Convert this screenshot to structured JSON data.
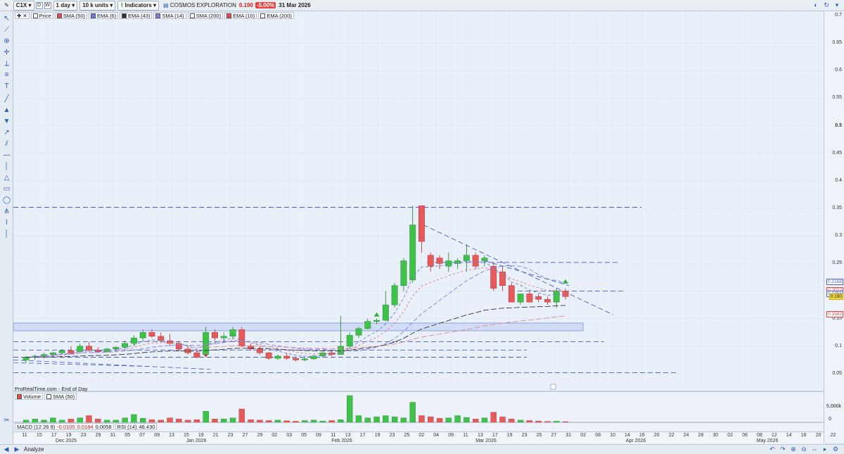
{
  "toolbar": {
    "symbol": "C1X",
    "period": "1 day",
    "units": "10 k units",
    "indicators_label": "Indicators",
    "instrument_name": "COSMOS EXPLORATION",
    "last_price": "0.190",
    "change_pct": "-5.00%",
    "date": "31 Mar 2026",
    "btn_d": "D",
    "btn_w": "W"
  },
  "legend": [
    {
      "label": "Price",
      "color": "#ffffff"
    },
    {
      "label": "SMA (50)",
      "color": "#e84a4a"
    },
    {
      "label": "EMA (6)",
      "color": "#6a7ce0"
    },
    {
      "label": "EMA (43)",
      "color": "#333333"
    },
    {
      "label": "SMA (14)",
      "color": "#7c83e8"
    },
    {
      "label": "SMA (200)",
      "color": "#ffffff"
    },
    {
      "label": "EMA (10)",
      "color": "#e84a4a"
    },
    {
      "label": "EMA (200)",
      "color": "#ffffff"
    }
  ],
  "source_text": "ProRealTime.com - End of Day",
  "volume_panel": {
    "label": "Volume",
    "sma_label": "SMA (50)",
    "tick_5000k": "5,000k",
    "tick_0": "0"
  },
  "macd_panel": {
    "label": "MACD (12 26 9)",
    "v1": "-0.0105",
    "v2": "0.0184",
    "v3": "0.0058",
    "rsi_label": "RSI (14)",
    "rsi_value": "48.430"
  },
  "price_axis": {
    "ticks": [
      "0.7",
      "0.65",
      "0.6",
      "0.55",
      "0.5",
      "0.45",
      "0.4",
      "0.35",
      "0.3",
      "0.25",
      "0.2",
      "0.15",
      "0.1",
      "0.05"
    ],
    "tags": [
      {
        "text": "0.2168",
        "value": 0.2168,
        "type": "blue"
      },
      {
        "text": "0.2023",
        "value": 0.2023,
        "type": "red"
      },
      {
        "text": "0.1956",
        "value": 0.1956,
        "type": "blue"
      },
      {
        "text": "0.190",
        "value": 0.19,
        "type": "yellow"
      },
      {
        "text": "0.1582",
        "value": 0.1582,
        "type": "red"
      }
    ]
  },
  "date_axis": {
    "days": [
      "11",
      "15",
      "17",
      "19",
      "23",
      "29",
      "31",
      "05",
      "07",
      "09",
      "13",
      "15",
      "19",
      "21",
      "23",
      "27",
      "29",
      "02",
      "03",
      "05",
      "09",
      "11",
      "13",
      "17",
      "19",
      "23",
      "25",
      "02",
      "04",
      "09",
      "11",
      "13",
      "17",
      "19",
      "23",
      "25",
      "27",
      "31",
      "02",
      "08",
      "10",
      "14",
      "16",
      "20",
      "22",
      "24",
      "28",
      "30",
      "02",
      "06",
      "08",
      "12",
      "14",
      "18",
      "20",
      "22"
    ],
    "months": [
      "Dec 2025",
      "Jan 2026",
      "Feb 2026",
      "Mar 2026",
      "Apr 2026",
      "May 2026"
    ]
  },
  "bottom": {
    "analyze_label": "Analyze"
  },
  "chart_data": {
    "type": "candlestick",
    "ylim": [
      0.0,
      0.72
    ],
    "candles": [
      {
        "o": 0.075,
        "h": 0.082,
        "l": 0.07,
        "c": 0.08
      },
      {
        "o": 0.08,
        "h": 0.085,
        "l": 0.075,
        "c": 0.082
      },
      {
        "o": 0.082,
        "h": 0.088,
        "l": 0.078,
        "c": 0.085
      },
      {
        "o": 0.085,
        "h": 0.09,
        "l": 0.08,
        "c": 0.088
      },
      {
        "o": 0.088,
        "h": 0.095,
        "l": 0.085,
        "c": 0.092
      },
      {
        "o": 0.092,
        "h": 0.1,
        "l": 0.085,
        "c": 0.087
      },
      {
        "o": 0.09,
        "h": 0.105,
        "l": 0.088,
        "c": 0.1
      },
      {
        "o": 0.1,
        "h": 0.108,
        "l": 0.09,
        "c": 0.093
      },
      {
        "o": 0.093,
        "h": 0.098,
        "l": 0.088,
        "c": 0.09
      },
      {
        "o": 0.09,
        "h": 0.097,
        "l": 0.088,
        "c": 0.095
      },
      {
        "o": 0.095,
        "h": 0.1,
        "l": 0.09,
        "c": 0.098
      },
      {
        "o": 0.098,
        "h": 0.11,
        "l": 0.095,
        "c": 0.105
      },
      {
        "o": 0.105,
        "h": 0.12,
        "l": 0.1,
        "c": 0.115
      },
      {
        "o": 0.115,
        "h": 0.13,
        "l": 0.11,
        "c": 0.125
      },
      {
        "o": 0.125,
        "h": 0.13,
        "l": 0.115,
        "c": 0.118
      },
      {
        "o": 0.118,
        "h": 0.125,
        "l": 0.108,
        "c": 0.11
      },
      {
        "o": 0.11,
        "h": 0.122,
        "l": 0.1,
        "c": 0.105
      },
      {
        "o": 0.105,
        "h": 0.11,
        "l": 0.09,
        "c": 0.095
      },
      {
        "o": 0.095,
        "h": 0.1,
        "l": 0.085,
        "c": 0.088
      },
      {
        "o": 0.088,
        "h": 0.095,
        "l": 0.078,
        "c": 0.08
      },
      {
        "o": 0.085,
        "h": 0.135,
        "l": 0.083,
        "c": 0.125
      },
      {
        "o": 0.125,
        "h": 0.13,
        "l": 0.11,
        "c": 0.115
      },
      {
        "o": 0.115,
        "h": 0.125,
        "l": 0.108,
        "c": 0.118
      },
      {
        "o": 0.118,
        "h": 0.135,
        "l": 0.112,
        "c": 0.13
      },
      {
        "o": 0.13,
        "h": 0.135,
        "l": 0.098,
        "c": 0.1
      },
      {
        "o": 0.1,
        "h": 0.105,
        "l": 0.092,
        "c": 0.095
      },
      {
        "o": 0.095,
        "h": 0.1,
        "l": 0.085,
        "c": 0.088
      },
      {
        "o": 0.088,
        "h": 0.09,
        "l": 0.075,
        "c": 0.078
      },
      {
        "o": 0.078,
        "h": 0.085,
        "l": 0.075,
        "c": 0.082
      },
      {
        "o": 0.082,
        "h": 0.088,
        "l": 0.075,
        "c": 0.078
      },
      {
        "o": 0.078,
        "h": 0.08,
        "l": 0.072,
        "c": 0.075
      },
      {
        "o": 0.075,
        "h": 0.08,
        "l": 0.073,
        "c": 0.077
      },
      {
        "o": 0.077,
        "h": 0.085,
        "l": 0.075,
        "c": 0.082
      },
      {
        "o": 0.082,
        "h": 0.09,
        "l": 0.08,
        "c": 0.088
      },
      {
        "o": 0.088,
        "h": 0.092,
        "l": 0.082,
        "c": 0.085
      },
      {
        "o": 0.085,
        "h": 0.155,
        "l": 0.085,
        "c": 0.1
      },
      {
        "o": 0.1,
        "h": 0.125,
        "l": 0.095,
        "c": 0.12
      },
      {
        "o": 0.12,
        "h": 0.135,
        "l": 0.115,
        "c": 0.132
      },
      {
        "o": 0.132,
        "h": 0.15,
        "l": 0.13,
        "c": 0.145
      },
      {
        "o": 0.145,
        "h": 0.15,
        "l": 0.14,
        "c": 0.147
      },
      {
        "o": 0.147,
        "h": 0.2,
        "l": 0.145,
        "c": 0.175
      },
      {
        "o": 0.175,
        "h": 0.215,
        "l": 0.17,
        "c": 0.21
      },
      {
        "o": 0.21,
        "h": 0.26,
        "l": 0.2,
        "c": 0.255
      },
      {
        "o": 0.22,
        "h": 0.355,
        "l": 0.215,
        "c": 0.32
      },
      {
        "o": 0.355,
        "h": 0.355,
        "l": 0.27,
        "c": 0.29
      },
      {
        "o": 0.265,
        "h": 0.27,
        "l": 0.235,
        "c": 0.245
      },
      {
        "o": 0.26,
        "h": 0.265,
        "l": 0.24,
        "c": 0.25
      },
      {
        "o": 0.245,
        "h": 0.27,
        "l": 0.235,
        "c": 0.255
      },
      {
        "o": 0.25,
        "h": 0.26,
        "l": 0.24,
        "c": 0.255
      },
      {
        "o": 0.255,
        "h": 0.285,
        "l": 0.235,
        "c": 0.265
      },
      {
        "o": 0.265,
        "h": 0.27,
        "l": 0.24,
        "c": 0.245
      },
      {
        "o": 0.255,
        "h": 0.265,
        "l": 0.245,
        "c": 0.26
      },
      {
        "o": 0.245,
        "h": 0.25,
        "l": 0.2,
        "c": 0.205
      },
      {
        "o": 0.235,
        "h": 0.245,
        "l": 0.2,
        "c": 0.21
      },
      {
        "o": 0.21,
        "h": 0.215,
        "l": 0.18,
        "c": 0.18
      },
      {
        "o": 0.18,
        "h": 0.195,
        "l": 0.175,
        "c": 0.195
      },
      {
        "o": 0.195,
        "h": 0.2,
        "l": 0.18,
        "c": 0.18
      },
      {
        "o": 0.19,
        "h": 0.195,
        "l": 0.18,
        "c": 0.185
      },
      {
        "o": 0.185,
        "h": 0.19,
        "l": 0.175,
        "c": 0.18
      },
      {
        "o": 0.18,
        "h": 0.205,
        "l": 0.17,
        "c": 0.2
      },
      {
        "o": 0.2,
        "h": 0.205,
        "l": 0.185,
        "c": 0.19
      }
    ],
    "volume": [
      1,
      1.5,
      1,
      2,
      1,
      1.5,
      2,
      3,
      1.5,
      1,
      1,
      2,
      3.5,
      1.8,
      1.2,
      1,
      2,
      1.5,
      1,
      1.2,
      5,
      1.5,
      1.5,
      2,
      6,
      1.2,
      1,
      0.8,
      1,
      0.7,
      0.5,
      0.8,
      1,
      0.6,
      0.8,
      1.2,
      12,
      3,
      2,
      2.5,
      3,
      2.5,
      2,
      9,
      3,
      2.5,
      1.8,
      2,
      3,
      2.2,
      1.5,
      2,
      4.5,
      2.5,
      1.5,
      1,
      0.8,
      0.6,
      0.4,
      0.5,
      0.3
    ]
  }
}
